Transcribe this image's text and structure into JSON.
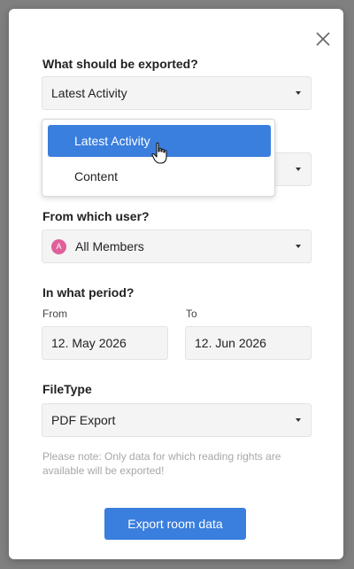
{
  "modal": {
    "close_icon": "close-icon"
  },
  "export_type": {
    "label": "What should be exported?",
    "value": "Latest Activity",
    "options": [
      "Latest Activity",
      "Content"
    ]
  },
  "user": {
    "label": "From which user?",
    "avatar_letter": "A",
    "avatar_color": "#e0609a",
    "value": "All Members"
  },
  "period": {
    "label": "In what period?",
    "from_label": "From",
    "from_value": "12. May 2026",
    "to_label": "To",
    "to_value": "12. Jun 2026"
  },
  "filetype": {
    "label": "FileType",
    "value": "PDF Export"
  },
  "note": "Please note: Only data for which reading rights are available will be exported!",
  "export_button": "Export room data",
  "colors": {
    "accent": "#3a7ede",
    "field_bg": "#f4f4f4"
  }
}
